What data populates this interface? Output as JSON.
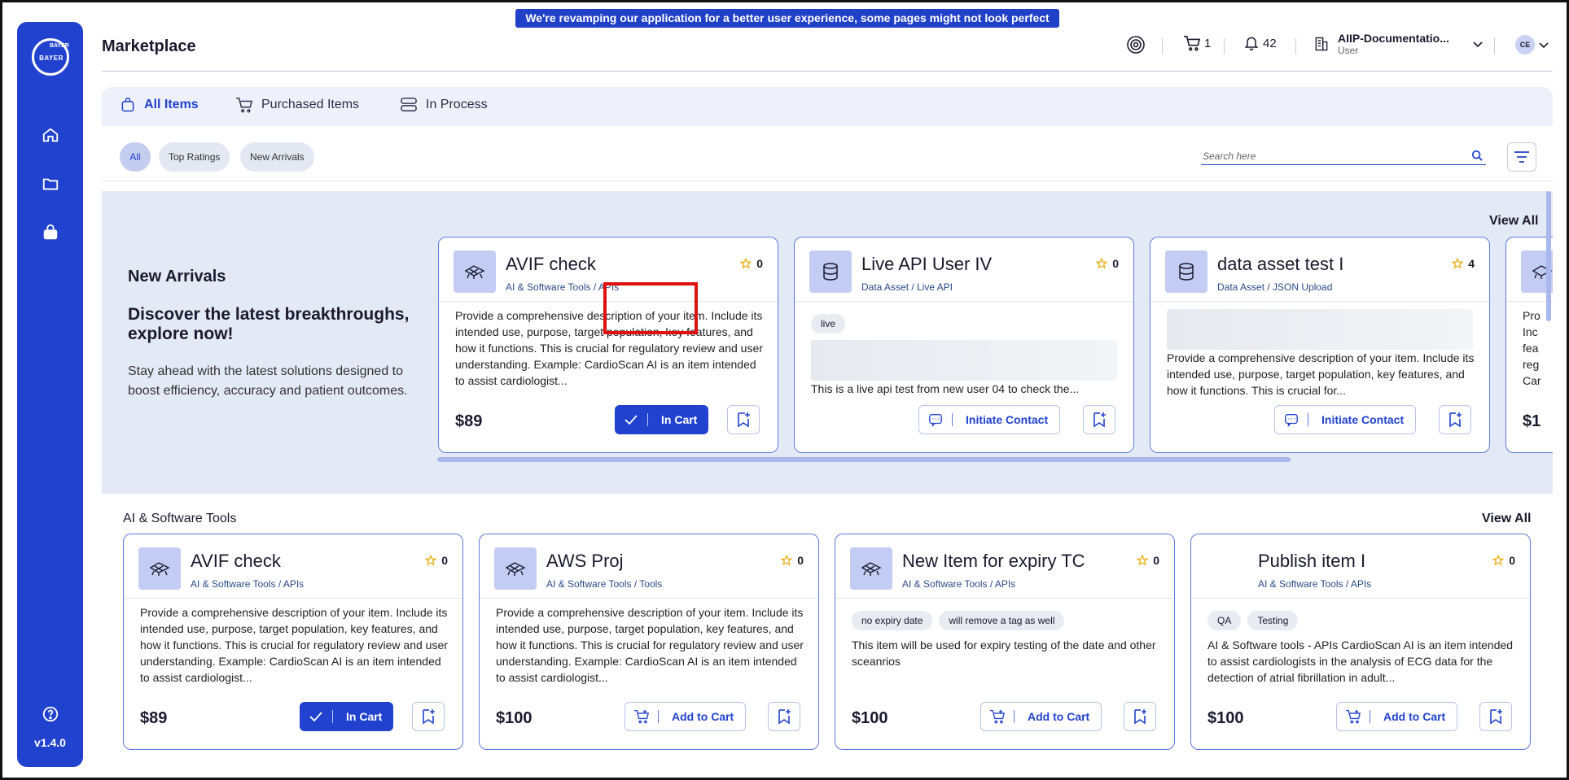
{
  "banner": "We're revamping our application for a better user experience, some pages might not look perfect yet!",
  "sidebar": {
    "logo_v": "BAYER",
    "logo_h": "BAYER",
    "version": "v1.4.0"
  },
  "header": {
    "title": "Marketplace",
    "cart_count": "1",
    "notification_count": "42",
    "org_name": "AIIP-Documentatio...",
    "org_role": "User",
    "avatar_initials": "CE"
  },
  "tabs": [
    "All Items",
    "Purchased Items",
    "In Process"
  ],
  "filters": {
    "chips": [
      "All",
      "Top Ratings",
      "New Arrivals"
    ],
    "search_placeholder": "Search here"
  },
  "new_arrivals": {
    "title": "New Arrivals",
    "headline": "Discover the latest breakthroughs, explore now!",
    "description": "Stay ahead with the latest solutions designed to boost efficiency, accuracy and patient outcomes.",
    "view_all": "View All",
    "cards": [
      {
        "title": "AVIF check",
        "category": "AI & Software Tools / APIs",
        "rating": "0",
        "description": "Provide a comprehensive description of your item. Include its intended use, purpose, target population, key features, and how it functions. This is crucial for regulatory review and user understanding. Example: CardioScan AI is an item intended to assist cardiologist...",
        "price": "$89",
        "action": "In Cart"
      },
      {
        "title": "Live API User IV",
        "category": "Data Asset / Live API",
        "rating": "0",
        "tag": "live",
        "description": "This is a live api test from new user 04 to check the...",
        "action": "Initiate Contact"
      },
      {
        "title": "data asset test I",
        "category": "Data Asset / JSON Upload",
        "rating": "4",
        "description": "Provide a comprehensive description of your item. Include its intended use, purpose, target population, key features, and how it functions. This is crucial for...",
        "action": "Initiate Contact"
      },
      {
        "description": "Pro Inc fea reg Car",
        "price": "$1"
      }
    ]
  },
  "ai_tools": {
    "title": "AI & Software Tools",
    "view_all": "View All",
    "cards": [
      {
        "title": "AVIF check",
        "category": "AI & Software Tools / APIs",
        "rating": "0",
        "description": "Provide a comprehensive description of your item. Include its intended use, purpose, target population, key features, and how it functions. This is crucial for regulatory review and user understanding. Example: CardioScan AI is an item intended to assist cardiologist...",
        "price": "$89",
        "action": "In Cart"
      },
      {
        "title": "AWS Proj",
        "category": "AI & Software Tools / Tools",
        "rating": "0",
        "description": "Provide a comprehensive description of your item. Include its intended use, purpose, target population, key features, and how it functions. This is crucial for regulatory review and user understanding. Example: CardioScan AI is an item intended to assist cardiologist...",
        "price": "$100",
        "action": "Add to Cart"
      },
      {
        "title": "New Item for expiry TC",
        "category": "AI & Software Tools / APIs",
        "rating": "0",
        "tags": [
          "no expiry date",
          "will remove a tag as well"
        ],
        "description": "This item will be used for expiry testing of the date and other sceanrios",
        "price": "$100",
        "action": "Add to Cart"
      },
      {
        "title": "Publish item I",
        "category": "AI & Software Tools / APIs",
        "rating": "0",
        "tags": [
          "QA",
          "Testing"
        ],
        "description": "AI & Software tools - APIs CardioScan AI is an item intended to assist cardiologists in the analysis of ECG data for the detection of atrial fibrillation in adult...",
        "price": "$100",
        "action": "Add to Cart"
      }
    ]
  },
  "colors": {
    "primary": "#2142cf",
    "highlight": "#e01010",
    "section_bg": "#e4e9f6"
  }
}
